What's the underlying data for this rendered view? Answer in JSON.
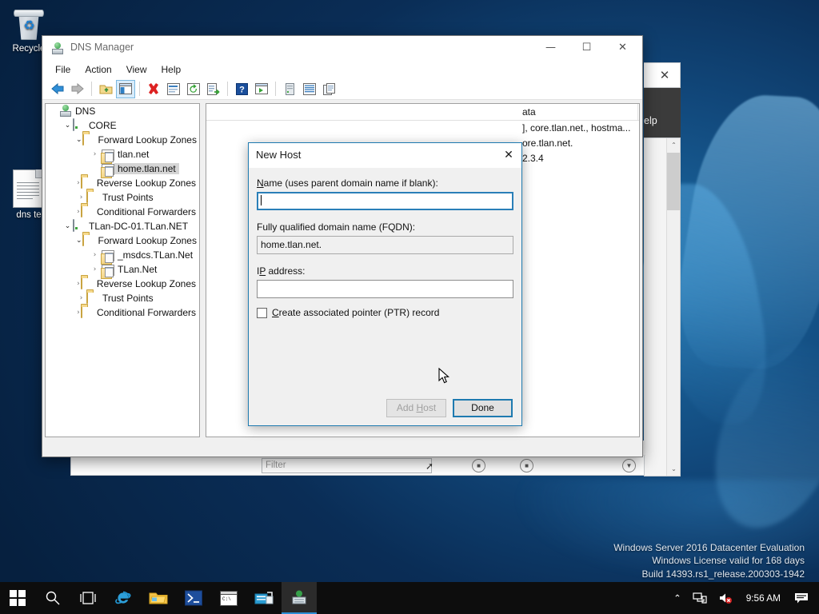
{
  "desktop": {
    "icons": [
      {
        "name": "recycle-bin",
        "label": "Recycle"
      },
      {
        "name": "text-document",
        "label": "dns te"
      }
    ]
  },
  "watermark": {
    "line1": "Windows Server 2016 Datacenter Evaluation",
    "line2": "Windows License valid for 168 days",
    "line3": "Build 14393.rs1_release.200303-1942"
  },
  "dns_window": {
    "title": "DNS Manager",
    "title_icon": "dns-server-icon",
    "window_buttons": {
      "minimize": "—",
      "maximize": "☐",
      "close": "✕"
    },
    "menus": [
      {
        "label": "File"
      },
      {
        "label": "Action"
      },
      {
        "label": "View"
      },
      {
        "label": "Help"
      }
    ],
    "toolbar": [
      {
        "name": "back-arrow-icon",
        "pressed": false
      },
      {
        "name": "forward-arrow-icon",
        "pressed": false
      },
      {
        "name": "separator"
      },
      {
        "name": "up-folder-icon",
        "pressed": false
      },
      {
        "name": "show-hide-console-tree-icon",
        "pressed": true
      },
      {
        "name": "separator"
      },
      {
        "name": "delete-icon",
        "pressed": false
      },
      {
        "name": "properties-icon",
        "pressed": false
      },
      {
        "name": "refresh-icon",
        "pressed": false
      },
      {
        "name": "export-list-icon",
        "pressed": false
      },
      {
        "name": "separator"
      },
      {
        "name": "help-icon",
        "pressed": false
      },
      {
        "name": "new-window-icon",
        "pressed": false
      },
      {
        "name": "separator"
      },
      {
        "name": "server-icon",
        "pressed": false
      },
      {
        "name": "list-icon",
        "pressed": false
      },
      {
        "name": "copy-icon",
        "pressed": false
      }
    ],
    "tree": [
      {
        "label": "DNS",
        "indent": 0,
        "icon": "dns-root-icon",
        "expander": "",
        "selected": false
      },
      {
        "label": "CORE",
        "indent": 1,
        "icon": "server-icon",
        "expander": "open",
        "selected": false
      },
      {
        "label": "Forward Lookup Zones",
        "indent": 2,
        "icon": "folder-icon",
        "expander": "open",
        "selected": false
      },
      {
        "label": "tlan.net",
        "indent": 3,
        "icon": "zone-icon",
        "expander": "closed",
        "selected": false
      },
      {
        "label": "home.tlan.net",
        "indent": 3,
        "icon": "zone-icon",
        "expander": "",
        "selected": true
      },
      {
        "label": "Reverse Lookup Zones",
        "indent": 2,
        "icon": "folder-icon",
        "expander": "closed",
        "selected": false
      },
      {
        "label": "Trust Points",
        "indent": 2,
        "icon": "folder-icon",
        "expander": "closed",
        "selected": false
      },
      {
        "label": "Conditional Forwarders",
        "indent": 2,
        "icon": "folder-icon",
        "expander": "closed",
        "selected": false
      },
      {
        "label": "TLan-DC-01.TLan.NET",
        "indent": 1,
        "icon": "server-icon",
        "expander": "open",
        "selected": false
      },
      {
        "label": "Forward Lookup Zones",
        "indent": 2,
        "icon": "folder-icon",
        "expander": "open",
        "selected": false
      },
      {
        "label": "_msdcs.TLan.Net",
        "indent": 3,
        "icon": "zone-icon",
        "expander": "closed",
        "selected": false
      },
      {
        "label": "TLan.Net",
        "indent": 3,
        "icon": "zone-icon",
        "expander": "closed",
        "selected": false
      },
      {
        "label": "Reverse Lookup Zones",
        "indent": 2,
        "icon": "folder-icon",
        "expander": "closed",
        "selected": false
      },
      {
        "label": "Trust Points",
        "indent": 2,
        "icon": "folder-icon",
        "expander": "closed",
        "selected": false
      },
      {
        "label": "Conditional Forwarders",
        "indent": 2,
        "icon": "folder-icon",
        "expander": "closed",
        "selected": false
      }
    ],
    "list": {
      "columns": [
        {
          "label": "ata"
        }
      ],
      "rows": [
        {
          "data": "], core.tlan.net., hostma..."
        },
        {
          "data": "ore.tlan.net."
        },
        {
          "data": "2.3.4"
        }
      ]
    }
  },
  "new_host_dialog": {
    "title": "New Host",
    "close_label": "✕",
    "name_label_pre": "",
    "name_label_accel": "N",
    "name_label_post": "ame (uses parent domain name if blank):",
    "name_value": "",
    "fqdn_label": "Fully qualified domain name (FQDN):",
    "fqdn_value": "home.tlan.net.",
    "ip_label_pre": "I",
    "ip_label_accel": "P",
    "ip_label_post": " address:",
    "ip_value": "",
    "checkbox_label_pre": "",
    "checkbox_label_accel": "C",
    "checkbox_label_post": "reate associated pointer (PTR) record",
    "checkbox_checked": false,
    "add_host_pre": "Add ",
    "add_host_accel": "H",
    "add_host_post": "ost",
    "add_host_enabled": false,
    "done_label": "Done",
    "done_is_default": true
  },
  "background_windows": {
    "right_panel": {
      "close_label": "✕",
      "help_text": "elp",
      "scroll_up": "⌃",
      "scroll_down": "⌄"
    },
    "bottom_panel": {
      "filter_placeholder": "Filter",
      "search_icon": "search-icon"
    }
  },
  "taskbar": {
    "items": [
      {
        "name": "start-button",
        "icon": "windows-logo-icon",
        "active": false
      },
      {
        "name": "search-button",
        "icon": "search-icon",
        "active": false
      },
      {
        "name": "task-view-button",
        "icon": "task-view-icon",
        "active": false
      },
      {
        "name": "internet-explorer",
        "icon": "internet-explorer-icon",
        "active": false
      },
      {
        "name": "file-explorer",
        "icon": "file-explorer-icon",
        "active": false
      },
      {
        "name": "powershell",
        "icon": "powershell-icon",
        "active": false
      },
      {
        "name": "command-prompt",
        "icon": "command-prompt-icon",
        "active": false
      },
      {
        "name": "server-manager",
        "icon": "server-manager-icon",
        "active": false
      },
      {
        "name": "dns-manager",
        "icon": "dns-manager-icon",
        "active": true
      }
    ],
    "tray": {
      "chevron": "⌃",
      "network_icon": "network-icon",
      "volume_icon": "volume-muted-icon",
      "clock": "9:56 AM",
      "action_center_icon": "action-center-icon"
    }
  }
}
